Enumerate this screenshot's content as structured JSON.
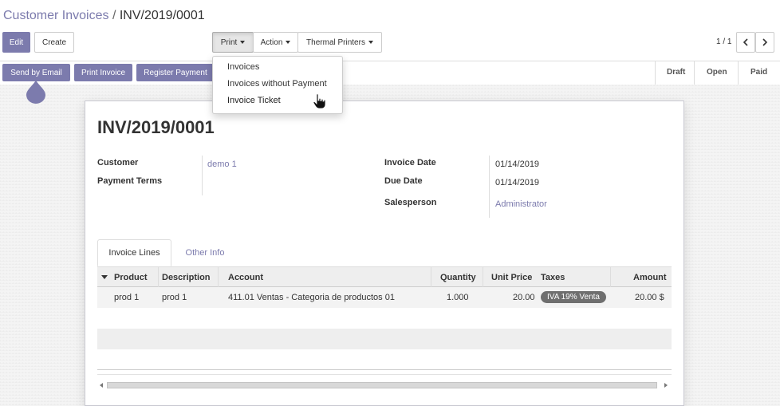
{
  "breadcrumb": {
    "parent": "Customer Invoices",
    "separator": "/",
    "current": "INV/2019/0001"
  },
  "buttons": {
    "edit": "Edit",
    "create": "Create",
    "print": "Print",
    "action": "Action",
    "thermal_printers": "Thermal Printers",
    "send_by_email": "Send by Email",
    "print_invoice": "Print Invoice",
    "register_payment": "Register Payment"
  },
  "pager": {
    "value": "1 / 1",
    "prev_icon": "chevron-left-icon",
    "next_icon": "chevron-right-icon"
  },
  "print_menu": {
    "items": [
      "Invoices",
      "Invoices without Payment",
      "Invoice Ticket"
    ],
    "hovered": "Invoice Ticket"
  },
  "statusbar": {
    "stages": [
      "Draft",
      "Open",
      "Paid"
    ]
  },
  "invoice": {
    "number": "INV/2019/0001",
    "customer_label": "Customer",
    "customer_value": "demo 1",
    "payment_terms_label": "Payment Terms",
    "payment_terms_value": "",
    "invoice_date_label": "Invoice Date",
    "invoice_date_value": "01/14/2019",
    "due_date_label": "Due Date",
    "due_date_value": "01/14/2019",
    "salesperson_label": "Salesperson",
    "salesperson_value": "Administrator"
  },
  "tabs": [
    "Invoice Lines",
    "Other Info"
  ],
  "lines_table": {
    "columns": [
      "Product",
      "Description",
      "Account",
      "Quantity",
      "Unit Price",
      "Taxes",
      "Amount"
    ],
    "rows": [
      {
        "product": "prod 1",
        "description": "prod 1",
        "account": "411.01 Ventas - Categoria de productos 01",
        "quantity": "1.000",
        "unit_price": "20.00",
        "taxes": "IVA 19% Venta",
        "amount": "20.00 $"
      }
    ]
  },
  "colors": {
    "primary": "#7c7bad",
    "badge": "#6f6f6f"
  }
}
